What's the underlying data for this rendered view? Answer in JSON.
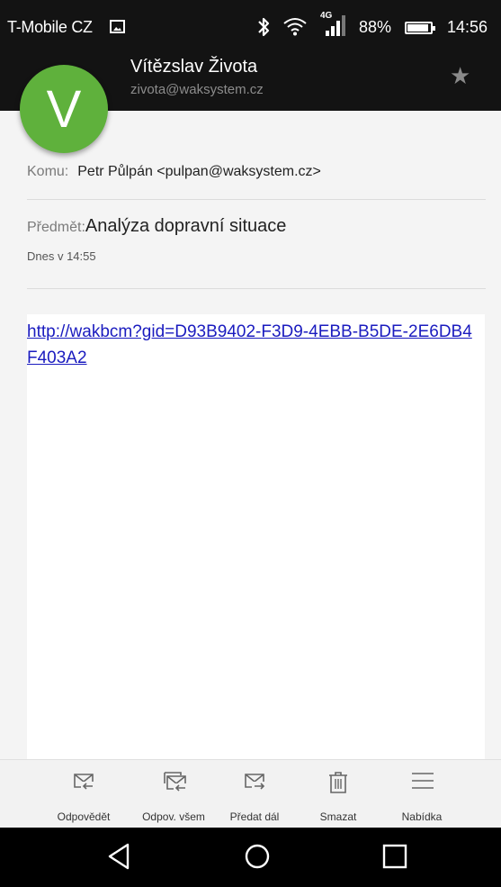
{
  "status_bar": {
    "carrier": "T-Mobile CZ",
    "network_type": "4G",
    "battery_percent": "88%",
    "time": "14:56",
    "icons": [
      "gallery-icon",
      "bluetooth-icon",
      "wifi-icon",
      "signal-icon",
      "battery-icon"
    ]
  },
  "sender": {
    "avatar_letter": "V",
    "avatar_color": "#5fb13c",
    "name": "Vítězslav Života",
    "email": "zivota@waksystem.cz"
  },
  "header": {
    "to_label": "Komu:",
    "to_value": "Petr Půlpán <pulpan@waksystem.cz>",
    "subject_label": "Předmět:",
    "subject_value": "Analýza dopravní situace",
    "date": "Dnes v 14:55"
  },
  "body": {
    "link": "http://wakbcm?gid=D93B9402-F3D9-4EBB-B5DE-2E6DB4F403A2",
    "link_color": "#1a1bbf"
  },
  "actions": [
    {
      "label": "Odpovědět",
      "icon": "reply-icon"
    },
    {
      "label": "Odpov. všem",
      "icon": "reply-all-icon"
    },
    {
      "label": "Předat dál",
      "icon": "forward-icon"
    },
    {
      "label": "Smazat",
      "icon": "trash-icon"
    },
    {
      "label": "Nabídka",
      "icon": "menu-icon"
    }
  ],
  "nav_bar": {
    "icons": [
      "back-icon",
      "home-icon",
      "recents-icon"
    ]
  }
}
